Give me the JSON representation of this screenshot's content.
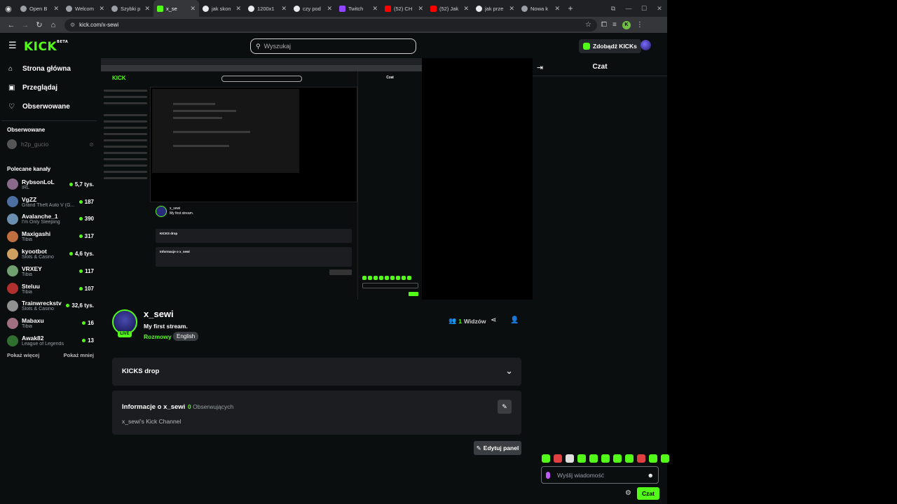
{
  "browser": {
    "tabs": [
      {
        "title": "",
        "icon": "tab-search-icon",
        "fav": "g"
      },
      {
        "title": "Open B",
        "icon": "github-icon",
        "fav": ""
      },
      {
        "title": "Welcom",
        "icon": "github-icon",
        "fav": ""
      },
      {
        "title": "Szybki p",
        "icon": "github-icon",
        "fav": ""
      },
      {
        "title": "x_se",
        "icon": "kick-icon",
        "fav": "kick",
        "active": true
      },
      {
        "title": "jak skon",
        "icon": "google-icon",
        "fav": "g"
      },
      {
        "title": "1200x1",
        "icon": "google-icon",
        "fav": "g"
      },
      {
        "title": "czy pod",
        "icon": "google-icon",
        "fav": "g"
      },
      {
        "title": "Twitch",
        "icon": "twitch-icon",
        "fav": "tw"
      },
      {
        "title": "(52) CH",
        "icon": "youtube-icon",
        "fav": "yt"
      },
      {
        "title": "(52) Jak",
        "icon": "youtube-icon",
        "fav": "yt"
      },
      {
        "title": "jak prze",
        "icon": "google-icon",
        "fav": "g"
      },
      {
        "title": "Nowa k",
        "icon": "chrome-icon",
        "fav": ""
      }
    ],
    "url": "kick.com/x-sewi",
    "profile_letter": "K"
  },
  "header": {
    "logo": "KICK",
    "logo_beta": "BETA",
    "search_placeholder": "Wyszukaj",
    "get_kicks": "Zdobądź KICKs"
  },
  "sidebar": {
    "nav": [
      {
        "label": "Strona główna",
        "icon": "home-icon"
      },
      {
        "label": "Przeglądaj",
        "icon": "browse-icon"
      },
      {
        "label": "Obserwowane",
        "icon": "heart-icon"
      }
    ],
    "followed_heading": "Obserwowane",
    "followed": [
      {
        "name": "h2p_gucio"
      }
    ],
    "recommended_heading": "Polecane kanały",
    "recommended": [
      {
        "name": "RybsonLoL",
        "category": "IRL",
        "viewers": "5,7 tys.",
        "color": "#8a6a8a"
      },
      {
        "name": "VgZZ",
        "category": "Grand Theft Auto V (G...",
        "viewers": "187",
        "color": "#4a6fa0"
      },
      {
        "name": "Avalanche_1",
        "category": "I'm Only Sleeping",
        "viewers": "390",
        "color": "#6a8fb0"
      },
      {
        "name": "Maxigashi",
        "category": "Tibia",
        "viewers": "317",
        "color": "#c07040"
      },
      {
        "name": "kyootbot",
        "category": "Slots & Casino",
        "viewers": "4,6 tys.",
        "color": "#d0a060"
      },
      {
        "name": "VRXEY",
        "category": "Tibia",
        "viewers": "117",
        "color": "#70a070"
      },
      {
        "name": "Steluu",
        "category": "Tibia",
        "viewers": "107",
        "color": "#b03030"
      },
      {
        "name": "Trainwreckstv",
        "category": "Slots & Casino",
        "viewers": "32,6 tys.",
        "color": "#909090"
      },
      {
        "name": "Mabaxu",
        "category": "Tibia",
        "viewers": "16",
        "color": "#a07080"
      },
      {
        "name": "Awak82",
        "category": "League of Legends",
        "viewers": "13",
        "color": "#2f6f2f"
      }
    ],
    "show_more": "Pokaż więcej",
    "show_less": "Pokaż mniej"
  },
  "channel": {
    "name": "x_sewi",
    "title": "My first stream.",
    "category": "Rozmowy",
    "language": "English",
    "live": "LIVE",
    "viewers": "1",
    "viewers_label": "Widzów"
  },
  "panels": {
    "drop_title": "KICKS drop",
    "about_title": "Informacje o x_sewi",
    "followers_count": "0",
    "followers_label": "Obserwujących",
    "about_desc": "x_sewi's Kick Channel",
    "edit_panel": "Edytuj panel"
  },
  "chat": {
    "title": "Czat",
    "placeholder": "Wyślij wiadomość",
    "send": "Czat",
    "emote_colors": [
      "#53fc18",
      "#e04040",
      "#e0e0e0",
      "#53fc18",
      "#53fc18",
      "#53fc18",
      "#53fc18",
      "#53fc18",
      "#e04040",
      "#53fc18",
      "#53fc18"
    ]
  }
}
